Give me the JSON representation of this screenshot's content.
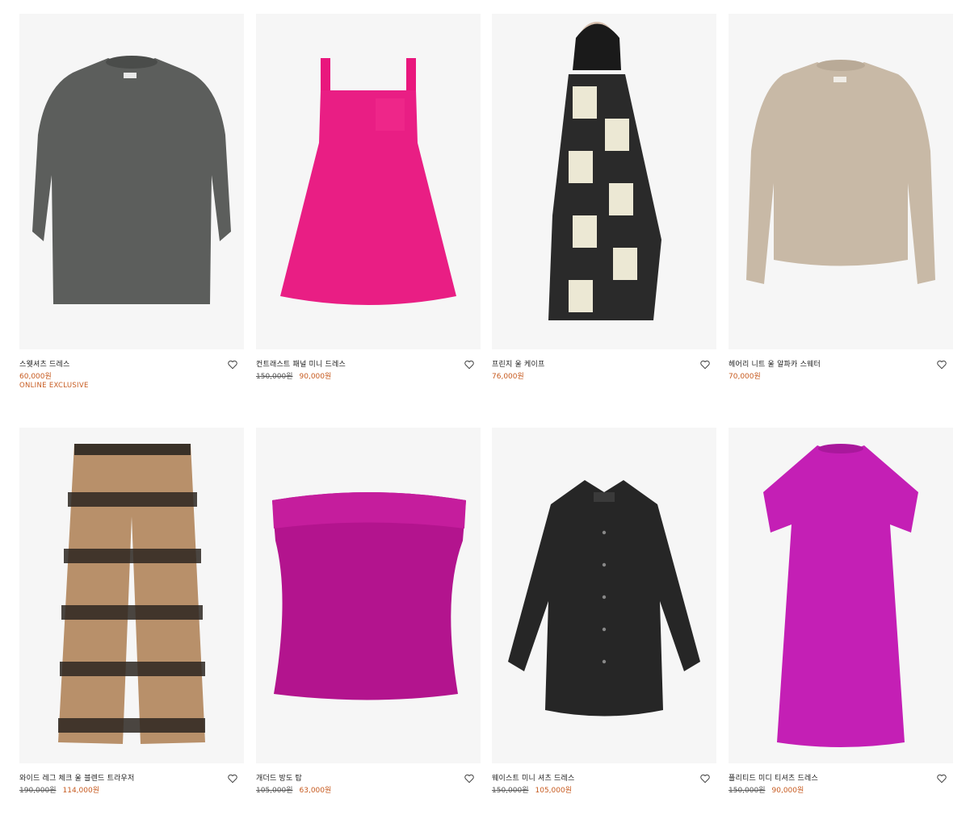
{
  "colors": {
    "sale": "#c75b20",
    "text": "#222222",
    "image_bg": "#f6f6f6"
  },
  "products": [
    {
      "name": "스웻셔츠 드레스",
      "price": "60,000원",
      "badge": "ONLINE EXCLUSIVE",
      "wishlist_icon": "heart-outline-icon"
    },
    {
      "name": "컨트래스트 패널 미니 드레스",
      "old_price": "150,000원",
      "price": "90,000원",
      "wishlist_icon": "heart-outline-icon"
    },
    {
      "name": "프린지 울 케이프",
      "price": "76,000원",
      "wishlist_icon": "heart-outline-icon"
    },
    {
      "name": "헤어리 니트 울 알파카 스웨터",
      "price": "70,000원",
      "wishlist_icon": "heart-outline-icon"
    },
    {
      "name": "와이드 레그 체크 울 블렌드 트라우저",
      "old_price": "190,000원",
      "price": "114,000원",
      "wishlist_icon": "heart-outline-icon"
    },
    {
      "name": "개더드 방도 탑",
      "old_price": "105,000원",
      "price": "63,000원",
      "wishlist_icon": "heart-outline-icon"
    },
    {
      "name": "웨이스트 미니 셔츠 드레스",
      "old_price": "150,000원",
      "price": "105,000원",
      "wishlist_icon": "heart-outline-icon"
    },
    {
      "name": "플리티드 미디 티셔츠 드레스",
      "old_price": "150,000원",
      "price": "90,000원",
      "wishlist_icon": "heart-outline-icon"
    }
  ]
}
